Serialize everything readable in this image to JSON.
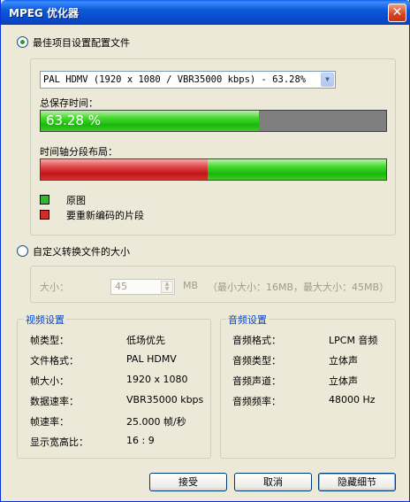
{
  "window": {
    "title": "MPEG 优化器",
    "close_glyph": "✕"
  },
  "option_best": {
    "label": "最佳项目设置配置文件",
    "selected": true,
    "profile_select": {
      "value": "PAL HDMV (1920 x 1080 / VBR35000 kbps) - 63.28%"
    },
    "total_saved_label": "总保存时间：",
    "total_saved_percent_text": "63.28 %",
    "total_saved_fraction": 0.6328,
    "timeline_label": "时间轴分段布局：",
    "timeline_reencode_fraction": 0.483,
    "legend": [
      {
        "label": "原图",
        "color": "#2eb82a"
      },
      {
        "label": "要重新编码的片段",
        "color": "#d32a2a"
      }
    ]
  },
  "option_custom": {
    "label": "自定义转换文件的大小",
    "selected": false,
    "size_label": "大小：",
    "size_value": "45",
    "size_unit": "MB",
    "size_range": "（最小大小：16MB，最大大小：45MB）"
  },
  "video": {
    "title": "视频设置",
    "rows": [
      {
        "k": "帧类型：",
        "v": "低场优先"
      },
      {
        "k": "文件格式：",
        "v": "PAL HDMV"
      },
      {
        "k": "帧大小：",
        "v": "1920 x 1080"
      },
      {
        "k": "数据速率：",
        "v": "VBR35000 kbps"
      },
      {
        "k": "帧速率：",
        "v": "25.000 帧/秒"
      },
      {
        "k": "显示宽高比：",
        "v": "16 : 9"
      }
    ]
  },
  "audio": {
    "title": "音频设置",
    "rows": [
      {
        "k": "音频格式：",
        "v": "LPCM 音频"
      },
      {
        "k": "音频类型：",
        "v": "立体声"
      },
      {
        "k": "音频声道：",
        "v": "立体声"
      },
      {
        "k": "音频频率：",
        "v": "48000 Hz"
      }
    ]
  },
  "buttons": {
    "accept": "接受",
    "cancel": "取消",
    "hide_details": "隐藏细节"
  }
}
